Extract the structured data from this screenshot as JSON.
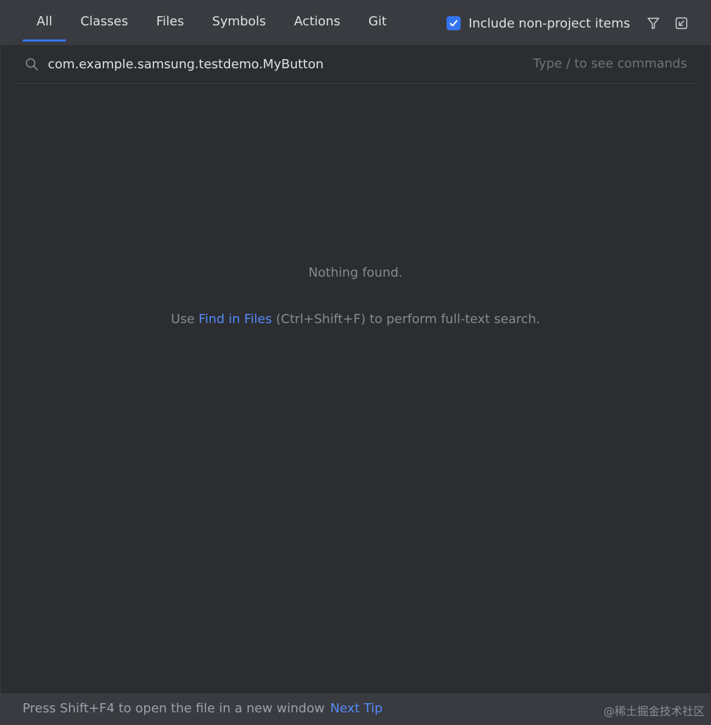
{
  "tabs": [
    {
      "label": "All",
      "active": true
    },
    {
      "label": "Classes",
      "active": false
    },
    {
      "label": "Files",
      "active": false
    },
    {
      "label": "Symbols",
      "active": false
    },
    {
      "label": "Actions",
      "active": false
    },
    {
      "label": "Git",
      "active": false
    }
  ],
  "header": {
    "include_non_project": {
      "label": "Include non-project items",
      "checked": true
    },
    "icons": [
      "filter-icon",
      "collapse-window-icon"
    ]
  },
  "search": {
    "value": "com.example.samsung.testdemo.MyButton",
    "hint": "Type / to see commands"
  },
  "empty_state": {
    "title": "Nothing found.",
    "hint_prefix": "Use ",
    "hint_link": "Find in Files",
    "hint_suffix": " (Ctrl+Shift+F) to perform full-text search."
  },
  "footer": {
    "tip": "Press Shift+F4 to open the file in a new window",
    "next_tip": "Next Tip",
    "watermark": "@稀土掘金技术社区"
  },
  "colors": {
    "background": "#2b2d30",
    "header": "#393b40",
    "accent": "#3574f0",
    "link": "#548af7",
    "muted_text": "#868a91"
  }
}
